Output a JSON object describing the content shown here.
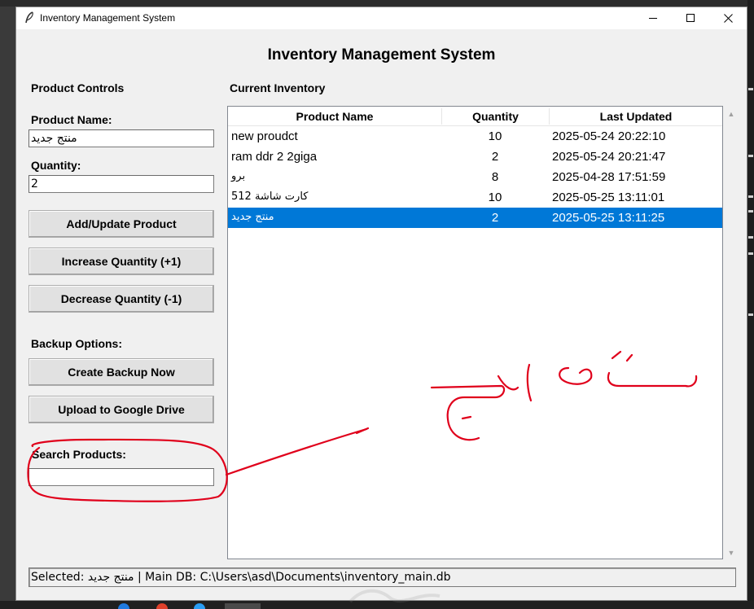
{
  "window": {
    "title": "Inventory Management System"
  },
  "app": {
    "heading": "Inventory Management System"
  },
  "controls": {
    "section_title": "Product Controls",
    "product_name_label": "Product Name:",
    "product_name_value": "منتج جديد",
    "quantity_label": "Quantity:",
    "quantity_value": "2",
    "add_update_label": "Add/Update Product",
    "increase_label": "Increase Quantity (+1)",
    "decrease_label": "Decrease Quantity (-1)",
    "backup_title": "Backup Options:",
    "create_backup_label": "Create Backup Now",
    "upload_drive_label": "Upload to Google Drive",
    "search_label": "Search Products:",
    "search_value": ""
  },
  "inventory": {
    "section_title": "Current Inventory",
    "columns": [
      "Product Name",
      "Quantity",
      "Last Updated"
    ],
    "rows": [
      {
        "name": "new proudct",
        "quantity": "10",
        "updated": "2025-05-24 20:22:10",
        "selected": false
      },
      {
        "name": "ram ddr 2  2giga",
        "quantity": "2",
        "updated": "2025-05-24 20:21:47",
        "selected": false
      },
      {
        "name": "برو",
        "quantity": "8",
        "updated": "2025-04-28 17:51:59",
        "selected": false
      },
      {
        "name": "كارت شاشة 512",
        "quantity": "10",
        "updated": "2025-05-25 13:11:01",
        "selected": false
      },
      {
        "name": "منتج جديد",
        "quantity": "2",
        "updated": "2025-05-25 13:11:25",
        "selected": true
      }
    ]
  },
  "status_bar": {
    "text": "Selected: منتج جديد | Main DB: C:\\Users\\asd\\Documents\\inventory_main.db"
  },
  "colors": {
    "selection": "#0078d7",
    "annotation": "#e0001b"
  },
  "icons": {
    "app": "feather-icon",
    "minimize": "minimize-icon",
    "maximize": "maximize-icon",
    "close": "close-icon"
  }
}
